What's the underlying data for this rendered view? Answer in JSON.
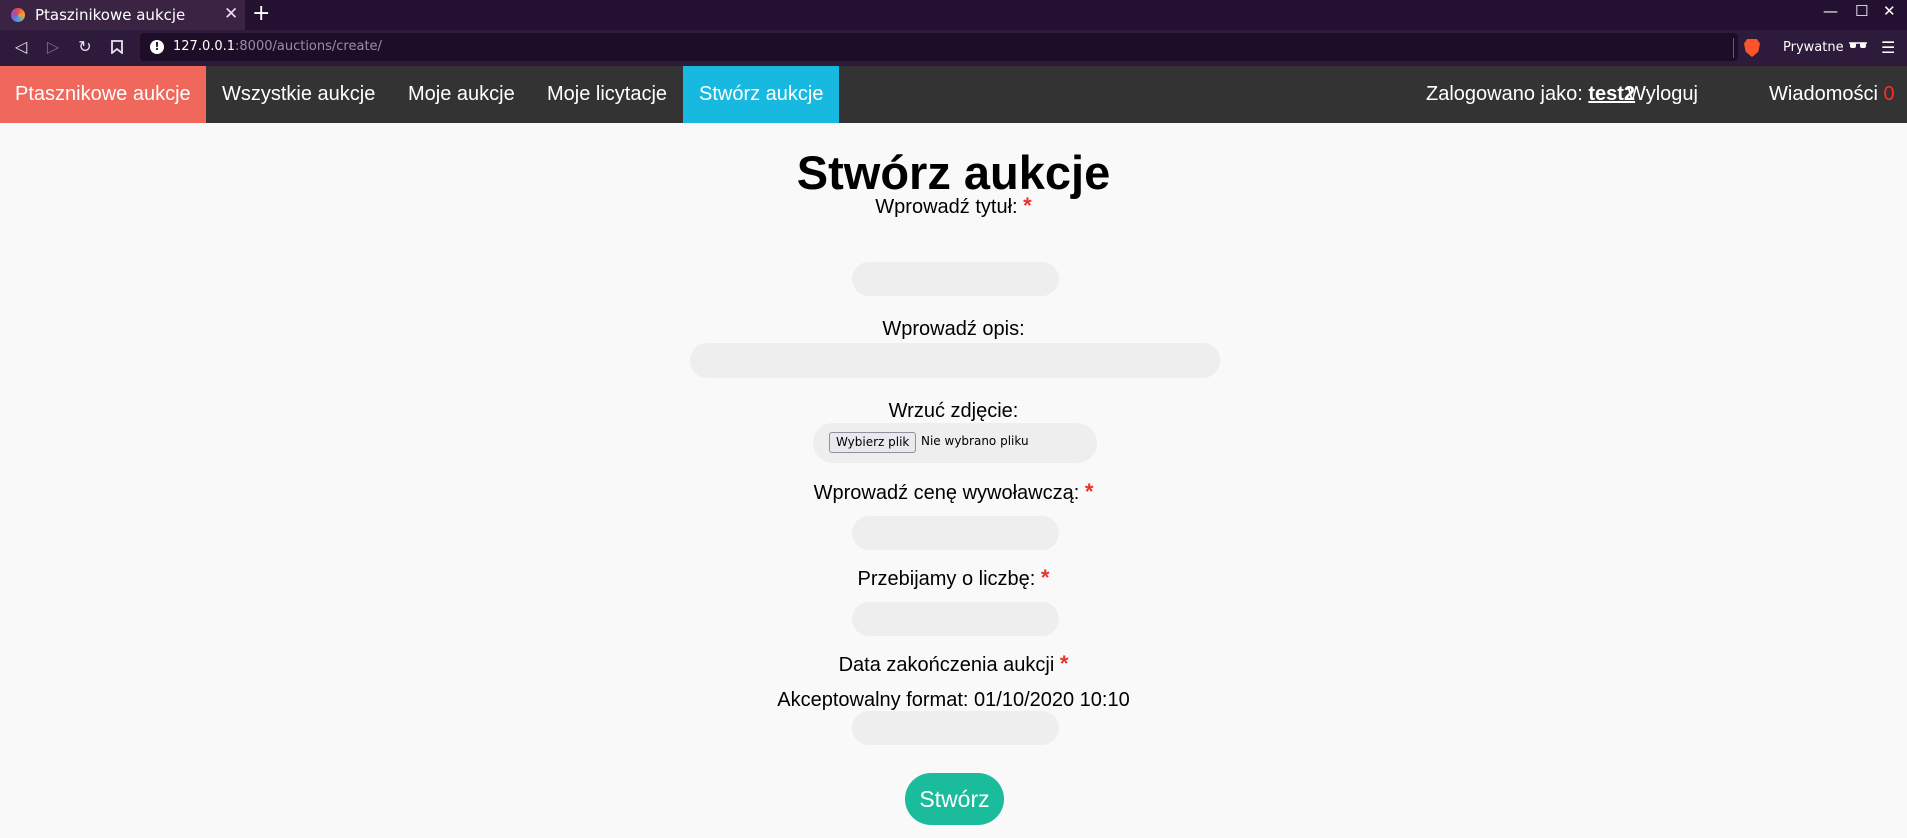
{
  "browser": {
    "tab_title": "Ptaszinikowe aukcje",
    "tab_close": "✕",
    "new_tab": "+",
    "window_controls": {
      "minimize": "—",
      "maximize": "☐",
      "close": "✕"
    },
    "back": "◁",
    "forward": "▷",
    "reload": "↻",
    "bookmark": "🔖",
    "url_host": "127.0.0.1",
    "url_rest": ":8000/auctions/create/",
    "private_label": "Prywatne",
    "private_icon": "🕶",
    "menu_icon": "☰",
    "icons": [
      "back-icon",
      "forward-icon",
      "reload-icon",
      "bookmark-icon",
      "site-info-icon",
      "brave-shield-icon",
      "private-glasses-icon",
      "menu-icon"
    ]
  },
  "nav": {
    "brand": "Ptasznikowe aukcje",
    "items": [
      "Wszystkie aukcje",
      "Moje aukcje",
      "Moje licytacje",
      "Stwórz aukcje"
    ],
    "active_index": 3,
    "user_prefix": "Zalogowano jako: ",
    "username": "test2",
    "logout": "Wyloguj",
    "messages": "Wiadomości",
    "messages_count": "0",
    "colors": {
      "bar": "#333333",
      "brand": "#f0675c",
      "active": "#17b9e0",
      "count": "#ff2b2b"
    }
  },
  "form": {
    "title": "Stwórz aukcje",
    "required_mark": "*",
    "fields": {
      "title_label": "Wprowadź tytuł:",
      "title_value": "",
      "description_label": "Wprowadź opis:",
      "description_value": "",
      "image_label": "Wrzuć zdjęcie:",
      "image_button": "Wybierz plik",
      "image_status": "Nie wybrano pliku",
      "price_label": "Wprowadź cenę wywoławczą:",
      "price_value": "",
      "increment_label": "Przebijamy o liczbę:",
      "increment_value": "",
      "end_date_label": "Data zakończenia aukcji",
      "end_date_hint": "Akceptowalny format: 01/10/2020 10:10",
      "end_date_value": ""
    },
    "submit": "Stwórz",
    "colors": {
      "required": "#e8322c",
      "submit": "#1abc9c",
      "field_bg": "#eeeeee"
    }
  }
}
